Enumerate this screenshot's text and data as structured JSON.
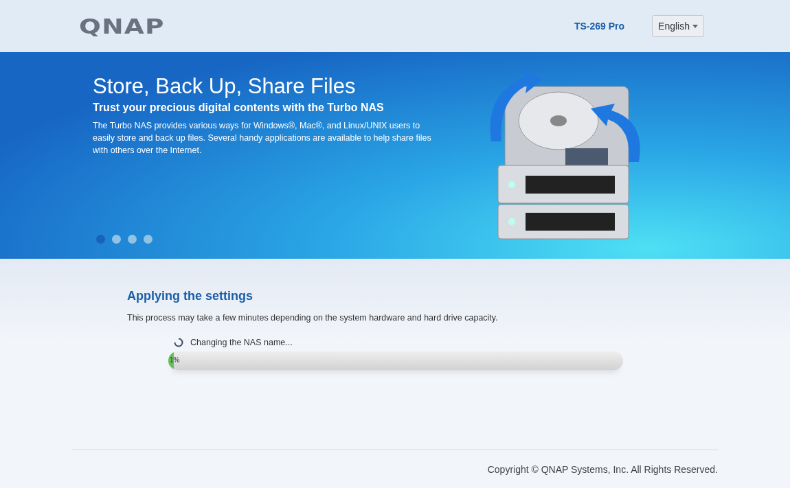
{
  "header": {
    "logo": "QNAP",
    "model": "TS-269 Pro",
    "language": "English"
  },
  "banner": {
    "title": "Store, Back Up, Share Files",
    "subtitle": "Trust your precious digital contents with the Turbo NAS",
    "description": "The Turbo NAS provides various ways for Windows®, Mac®, and Linux/UNIX users to easily store and back up files. Several handy applications are available to help share files with others over the Internet.",
    "slides": [
      {
        "selected": true
      },
      {
        "selected": false
      },
      {
        "selected": false
      },
      {
        "selected": false
      }
    ]
  },
  "progress": {
    "title": "Applying the settings",
    "note": "This process may take a few minutes depending on the system hardware and hard drive capacity.",
    "status": "Changing the NAS name...",
    "level": 0.01,
    "percent": "1%"
  },
  "footer": {
    "copyright": "Copyright © QNAP Systems, Inc. All Rights Reserved."
  }
}
